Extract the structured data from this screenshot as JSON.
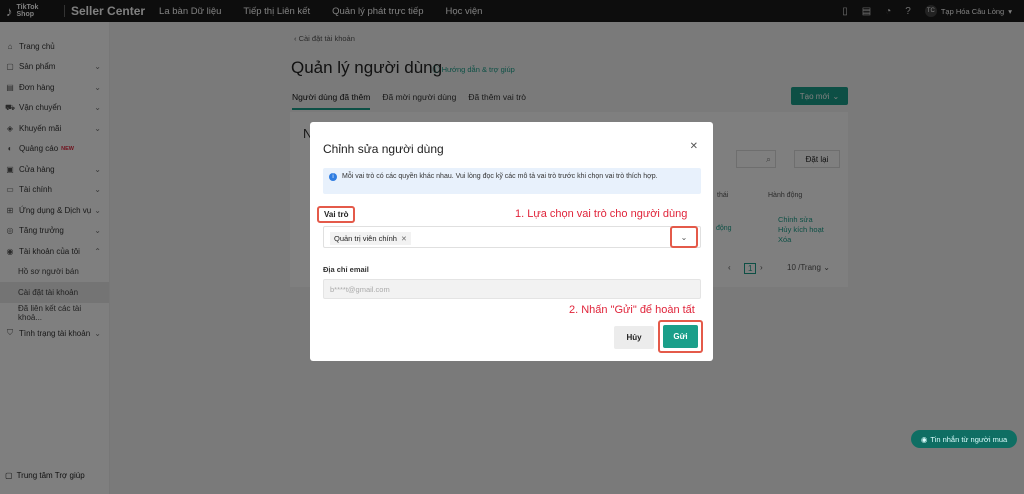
{
  "topbar": {
    "logo_line1": "TikTok",
    "logo_line2": "Shop",
    "brand": "Seller Center",
    "nav": [
      "La bàn Dữ liệu",
      "Tiếp thị Liên kết",
      "Quản lý phát trực tiếp",
      "Học viện"
    ],
    "user_initials": "TC",
    "user_name": "Tạp Hóa Câu Lòng"
  },
  "sidebar": {
    "items": [
      {
        "label": "Trang chủ",
        "icon": "home-icon",
        "glyph": "⌂",
        "chevron": false,
        "badge": ""
      },
      {
        "label": "Sản phẩm",
        "icon": "box-icon",
        "glyph": "▢",
        "chevron": true,
        "badge": ""
      },
      {
        "label": "Đơn hàng",
        "icon": "clipboard-icon",
        "glyph": "▤",
        "chevron": true,
        "badge": ""
      },
      {
        "label": "Vận chuyển",
        "icon": "truck-icon",
        "glyph": "⛟",
        "chevron": true,
        "badge": ""
      },
      {
        "label": "Khuyến mãi",
        "icon": "tag-icon",
        "glyph": "◈",
        "chevron": true,
        "badge": ""
      },
      {
        "label": "Quảng cáo",
        "icon": "megaphone-icon",
        "glyph": "◐",
        "chevron": false,
        "badge": "NEW"
      },
      {
        "label": "Cửa hàng",
        "icon": "store-icon",
        "glyph": "▣",
        "chevron": true,
        "badge": ""
      },
      {
        "label": "Tài chính",
        "icon": "wallet-icon",
        "glyph": "▭",
        "chevron": true,
        "badge": ""
      },
      {
        "label": "Ứng dụng & Dịch vụ",
        "icon": "apps-icon",
        "glyph": "⊞",
        "chevron": true,
        "badge": ""
      },
      {
        "label": "Tăng trưởng",
        "icon": "growth-icon",
        "glyph": "◎",
        "chevron": true,
        "badge": ""
      },
      {
        "label": "Tài khoản của tôi",
        "icon": "user-icon",
        "glyph": "◉",
        "chevron": true,
        "chevron_up": true,
        "badge": ""
      }
    ],
    "subitems": [
      {
        "label": "Hồ sơ người bán",
        "active": false
      },
      {
        "label": "Cài đặt tài khoản",
        "active": true
      },
      {
        "label": "Đã liên kết các tài khoả...",
        "active": false
      }
    ],
    "last_item": {
      "label": "Tình trạng tài khoản",
      "icon": "shield-icon",
      "glyph": "⛉"
    },
    "footer": "Trung tâm Trợ giúp"
  },
  "page": {
    "back_link": "Cài đặt tài khoản",
    "title": "Quản lý người dùng",
    "help_link": "Hướng dẫn & trợ giúp",
    "tabs": [
      "Người dùng đã thêm",
      "Đã mời người dùng",
      "Đã thêm vai trò"
    ],
    "create_button": "Tạo mới",
    "bg_letter": "N",
    "reset_button": "Đặt lại",
    "col_status": "thái",
    "col_actions": "Hành động",
    "status_value": "động",
    "actions": [
      "Chỉnh sửa",
      "Hủy kích hoạt",
      "Xóa"
    ],
    "page_number": "1",
    "page_size": "10 /Trang"
  },
  "modal": {
    "title": "Chỉnh sửa người dùng",
    "info": "Mỗi vai trò có các quyền khác nhau. Vui lòng đọc kỹ các mô tả vai trò trước khi chọn vai trò thích hợp.",
    "role_label": "Vai trò",
    "role_value": "Quản trị viên chính",
    "email_label": "Địa chỉ email",
    "email_value": "b****t@gmail.com",
    "cancel_label": "Hủy",
    "send_label": "Gửi"
  },
  "annotations": {
    "step1": "1. Lựa chọn vai trò cho người dùng",
    "step2": "2. Nhấn \"Gửi\" để hoàn tất"
  },
  "chat_button": "Tin nhắn từ người mua",
  "colors": {
    "accent": "#1a9f8a",
    "highlight": "#e45a4a",
    "annotation_text": "#e0243a",
    "topbar": "#1a1a1a"
  }
}
